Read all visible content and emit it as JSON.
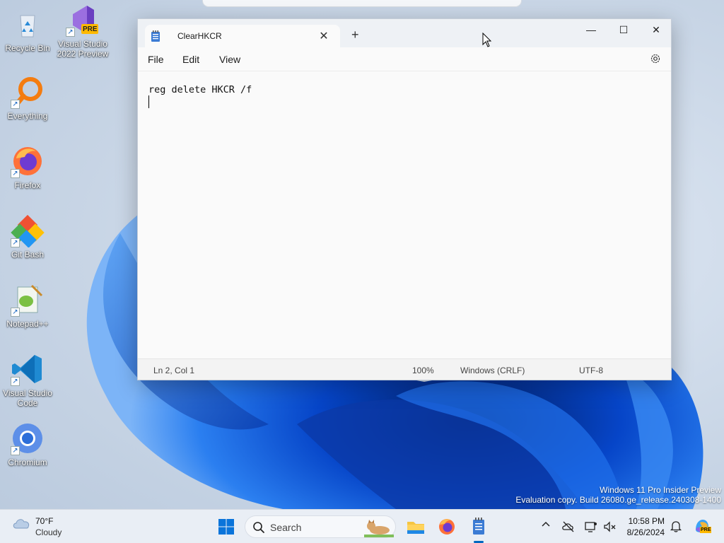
{
  "desktop": {
    "icons": [
      {
        "label": "Recycle Bin"
      },
      {
        "label": "Visual Studio 2022 Preview",
        "badge": "PRE"
      },
      {
        "label": "Everything"
      },
      {
        "label": "Firefox"
      },
      {
        "label": "Git Bash"
      },
      {
        "label": "Notepad++"
      },
      {
        "label": "Visual Studio Code"
      },
      {
        "label": "Chromium"
      }
    ],
    "watermark": {
      "line1": "Windows 11 Pro Insider Preview",
      "line2": "Evaluation copy. Build 26080.ge_release.240308-1400"
    }
  },
  "notepad": {
    "tab_title": "ClearHKCR",
    "new_tab": "+",
    "tab_close": "✕",
    "controls": {
      "minimize": "—",
      "maximize": "☐",
      "close": "✕"
    },
    "menu": {
      "file": "File",
      "edit": "Edit",
      "view": "View"
    },
    "content_line1": "reg delete HKCR /f",
    "status": {
      "position": "Ln 2, Col 1",
      "zoom": "100%",
      "line_ending": "Windows (CRLF)",
      "encoding": "UTF-8"
    }
  },
  "taskbar": {
    "weather_temp": "70°F",
    "weather_condition": "Cloudy",
    "search_label": "Search",
    "clock_time": "10:58 PM",
    "clock_date": "8/26/2024",
    "copilot_badge": "PRE"
  },
  "colors": {
    "accent": "#0067c0",
    "wallpaper_blue": "#0a5fd8",
    "taskbar_bg": "#e9eef5"
  }
}
